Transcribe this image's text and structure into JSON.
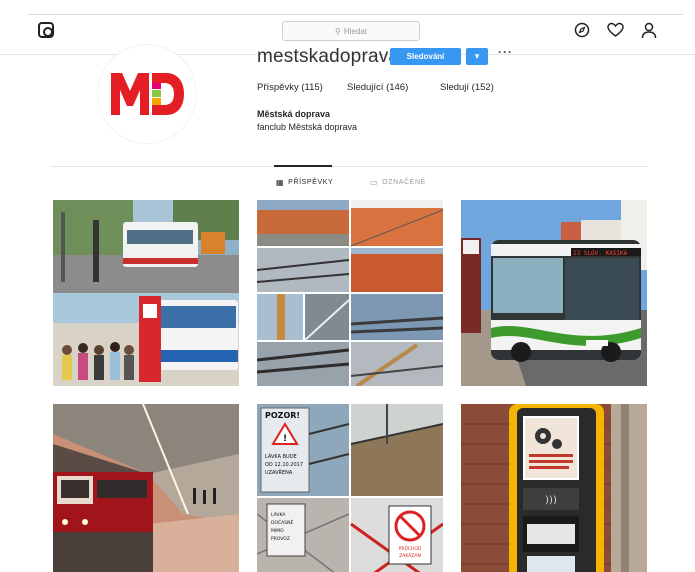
{
  "header": {
    "search_placeholder": "Hledat",
    "icons": [
      "instagram-icon",
      "explore-compass-icon",
      "heart-icon",
      "profile-icon"
    ]
  },
  "profile": {
    "username": "mestskadoprava",
    "follow_label": "Sledování",
    "logo_text": "MD",
    "stats": {
      "posts": "Příspěvky (115)",
      "followers": "Sledující (146)",
      "following": "Sledují (152)"
    },
    "bio_name": "Městská doprava",
    "bio_text": "fanclub Městská doprava"
  },
  "tabs": [
    {
      "label": "PŘÍSPĚVKY",
      "active": true
    },
    {
      "label": "OZNAČENÉ",
      "active": false
    }
  ],
  "posts": [
    {
      "id": "bus-stop-collage"
    },
    {
      "id": "construction-collage"
    },
    {
      "id": "green-bus"
    },
    {
      "id": "metro-train"
    },
    {
      "id": "bridge-signs-collage"
    },
    {
      "id": "ticket-machine"
    }
  ],
  "post_texts": {
    "bus_destination": "13 SLOV. KASIKA",
    "sign_top": "POZOR!",
    "sign_lines": [
      "LÁVKA BUDE",
      "OD 12.10.2017",
      "UZAVŘENA"
    ],
    "sign2_lines": [
      "LÁVKA",
      "DOČASNĚ",
      "MIMO",
      "PROVOZ"
    ],
    "sign3_lines": [
      "PRŮCHOD",
      "ZAKÁZÁN"
    ]
  },
  "colors": {
    "follow_blue": "#3897f0",
    "logo_red": "#e31e24",
    "logo_green": "#8dc63f",
    "logo_pink": "#e6007e"
  }
}
